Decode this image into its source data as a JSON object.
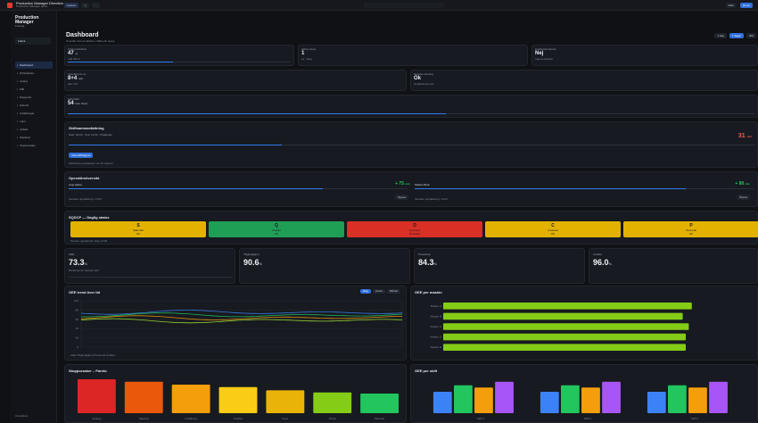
{
  "app": {
    "brand": "Production Manager Direction",
    "brand_sub": "Production Manager demo",
    "top_chip_primary": "Feature",
    "top_chip_ghost_1": "◷",
    "top_chip_ghost_2": "…",
    "top_right_pill_1": "Dark",
    "top_right_pill_2": "Demo"
  },
  "sidebar": {
    "app_name": "Production Manager",
    "org": "Företag",
    "select_value": "Fabrik",
    "items": [
      {
        "label": "Dashboard",
        "active": true
      },
      {
        "label": "Driftsvärden"
      },
      {
        "label": "Analys"
      },
      {
        "label": "Mål"
      },
      {
        "label": "Rapporter"
      },
      {
        "label": "Historik"
      },
      {
        "label": "Inställningar"
      },
      {
        "label": "Larm"
      },
      {
        "label": "Artiklar"
      },
      {
        "label": "Maskiner"
      },
      {
        "label": "Stopporsaker"
      }
    ],
    "footer": "Användare"
  },
  "header": {
    "title": "Dashboard",
    "subtitle": "Översikt över produktion, OEE och stopp",
    "actions": [
      "1 dag",
      "7 dagar",
      "30d"
    ]
  },
  "row1": [
    {
      "label": "Total produktion",
      "value": "47",
      "unit": "st",
      "meta": "mål 100 st",
      "progress": 0.47
    },
    {
      "label": "Aktiva stopp",
      "value": "1",
      "meta": "se - idag",
      "progress": 0.0
    },
    {
      "label": "Kvalitetsavvikelse",
      "value": "Nej",
      "meta": "Inga avvikelser",
      "progress": 0.0
    }
  ],
  "row2": [
    {
      "label": "Cykeltid just nu",
      "value": "8+4",
      "unit": "sek",
      "meta": "takt: 24s",
      "progress": 0.0
    },
    {
      "label": "Senaste ändring",
      "value": "Ok",
      "meta": "Uppdaterad nyss",
      "progress": 0.0
    }
  ],
  "row3": {
    "label": "Skiftmålet",
    "value": "54",
    "unit": "min",
    "meta": "Kvar",
    "progress": 0.55
  },
  "shift_panel": {
    "title": "Skiftsammanfattning",
    "detail": "Start: 06:00 · Slut: 14:00 · Pågående",
    "right_value": "31",
    "right_unit": "min",
    "button": "Visa skiftrapport",
    "note": "Skiftstatus uppdateras var 30 sekund",
    "progress": 0.31
  },
  "ops_panel": {
    "title": "Operatörsöversikt",
    "left": {
      "label": "Linje Alpha",
      "value": "+ 75",
      "unit": "min",
      "button": "Öppna",
      "note": "Senaste uppdatering: 14:02"
    },
    "right": {
      "label": "Maskin Beta",
      "value": "+ 80",
      "unit": "min",
      "button": "Öppna",
      "note": "Senaste uppdatering: 14:01"
    },
    "progress_left": 0.75,
    "progress_right": 0.8
  },
  "sqdcp": {
    "title": "SQDCP — Daglig status",
    "note": "Senast uppdaterad: idag 14:00",
    "items": [
      {
        "title": "S",
        "sub": "Säkerhet",
        "val": "OK"
      },
      {
        "title": "Q",
        "sub": "Kvalitet",
        "val": "OK"
      },
      {
        "title": "D",
        "sub": "Leverans",
        "val": "Avvikelse"
      },
      {
        "title": "C",
        "sub": "Kostnad",
        "val": "OK"
      },
      {
        "title": "P",
        "sub": "Personal",
        "val": "OK"
      }
    ],
    "colors": [
      "#e3b200",
      "#1f9e56",
      "#d93026",
      "#e3b200",
      "#e3b200"
    ]
  },
  "kpis": [
    {
      "label": "OEE",
      "value": "73.3",
      "unit": "%",
      "note": "Beräknad för aktuellt skift"
    },
    {
      "label": "Tillgänglighet",
      "value": "90.6",
      "unit": "%",
      "note": ""
    },
    {
      "label": "Prestanda",
      "value": "84.3",
      "unit": "%",
      "note": ""
    },
    {
      "label": "Kvalitet",
      "value": "96.0",
      "unit": "%",
      "note": ""
    }
  ],
  "chart_trend": {
    "type": "line",
    "title": "OEE trend över tid",
    "toggles": [
      "Dag",
      "Vecka",
      "Månad"
    ],
    "y_ticks": [
      "100",
      "80",
      "60",
      "40",
      "20",
      "0"
    ],
    "series": [
      {
        "name": "OEE",
        "color": "#3b82f6"
      },
      {
        "name": "Tillgänglighet",
        "color": "#22c55e"
      },
      {
        "name": "Prestanda",
        "color": "#f59e0b"
      },
      {
        "name": "Kvalitet",
        "color": "#a3e635"
      }
    ],
    "legend_text": "OEE  Tillgänglighet  Prestanda  Kvalitet"
  },
  "chart_oee_machine": {
    "type": "bar",
    "title": "OEE per maskin",
    "categories": [
      "Maskin A",
      "Maskin B",
      "Maskin C",
      "Maskin D",
      "Maskin E"
    ],
    "values": [
      82,
      79,
      81,
      80,
      80
    ],
    "xlim": [
      0,
      100
    ],
    "color": "#84cc16"
  },
  "chart_pareto": {
    "type": "bar",
    "title": "Stopporsaker – Pareto",
    "categories": [
      "Verktyg",
      "Material",
      "Inställning",
      "Kvalitet",
      "Paus",
      "Övrigt",
      "Planerat"
    ],
    "values": [
      95,
      88,
      80,
      73,
      64,
      58,
      55
    ],
    "colors": [
      "#dc2626",
      "#ea580c",
      "#f59e0b",
      "#facc15",
      "#eab308",
      "#84cc16",
      "#22c55e"
    ]
  },
  "chart_shift": {
    "type": "bar",
    "title": "OEE per skift",
    "categories": [
      "Skift 1",
      "Skift 2",
      "Skift 3"
    ],
    "series": [
      {
        "name": "OEE",
        "color": "#3b82f6",
        "values": [
          60,
          60,
          60
        ]
      },
      {
        "name": "Tillgänglighet",
        "color": "#22c55e",
        "values": [
          78,
          78,
          78
        ]
      },
      {
        "name": "Prestanda",
        "color": "#f59e0b",
        "values": [
          72,
          72,
          72
        ]
      },
      {
        "name": "Kvalitet",
        "color": "#a855f7",
        "values": [
          88,
          88,
          88
        ]
      }
    ],
    "ylim": [
      0,
      100
    ]
  }
}
